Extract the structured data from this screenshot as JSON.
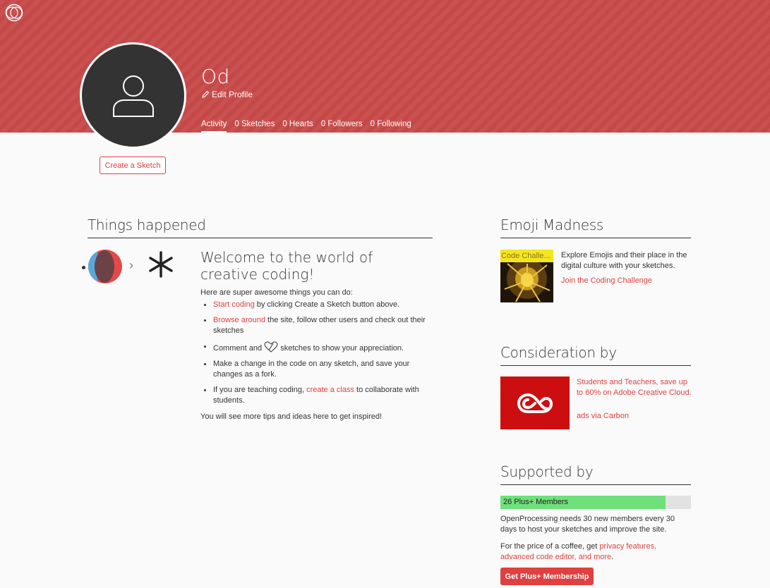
{
  "header": {
    "profile_name": "Od",
    "edit_profile_label": "Edit Profile",
    "tabs": [
      {
        "label": "Activity"
      },
      {
        "label": "0 Sketches"
      },
      {
        "label": "0 Hearts"
      },
      {
        "label": "0 Followers"
      },
      {
        "label": "0 Following"
      }
    ],
    "active_tab": "Activity",
    "create_sketch_label": "Create a Sketch"
  },
  "activity": {
    "section_title": "Things happened",
    "welcome_title": "Welcome to the world of creative coding!",
    "intro": "Here are super awesome things you can do:",
    "tips": [
      {
        "link": "Start coding",
        "text": " by clicking Create a Sketch button above."
      },
      {
        "link": "Browse around",
        "text": " the site, follow other users and check out their sketches"
      },
      {
        "before": "Comment and ",
        "after": " sketches to show your appreciation."
      },
      {
        "text": "Make a change in the code on any sketch, and save your changes as a fork."
      },
      {
        "before": "If you are teaching coding, ",
        "link": "create a class",
        "after": " to collaborate with students."
      }
    ],
    "outro": "You will see more tips and ideas here to get inspired!"
  },
  "sidebar": {
    "challenge": {
      "title": "Emoji Madness",
      "image_label": "Code Challe...",
      "text": "Explore Emojis and their place in the digital culture with your sketches.",
      "link": "Join the Coding Challenge"
    },
    "ad": {
      "title": "Consideration by",
      "text": "Students and Teachers, save up to 60% on Adobe Creative Cloud.",
      "via": "ads via Carbon"
    },
    "support": {
      "title": "Supported by",
      "progress_label": "26 Plus+ Members",
      "progress_fraction": 0.866,
      "text": "OpenProcessing needs 30 new members every 30 days to host your sketches and improve the site.",
      "price_before": "For the price of a coffee, get ",
      "price_link": "privacy features, advanced code editor, and more",
      "price_after": ".",
      "button_label": "Get Plus+ Membership"
    }
  },
  "colors": {
    "header_bg": "#c94b4b",
    "accent": "#e0403f",
    "progress_fill": "#6fe07a",
    "ad_red": "#cc0e10"
  }
}
